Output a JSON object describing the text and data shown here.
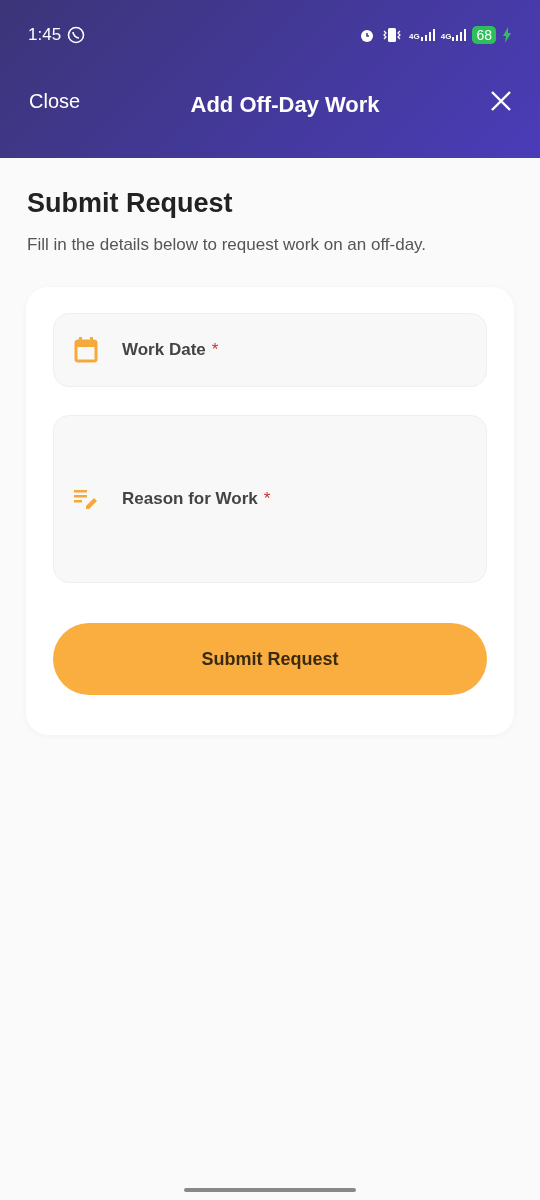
{
  "status_bar": {
    "time": "1:45",
    "network": [
      "4G",
      "4G"
    ],
    "battery": "68"
  },
  "header": {
    "close_label": "Close",
    "title": "Add Off-Day Work"
  },
  "intro": {
    "title": "Submit Request",
    "subtitle": "Fill in the details below to request work on an off-day."
  },
  "form": {
    "fields": [
      {
        "kind": "date",
        "label": "Work Date",
        "required_mark": "*"
      },
      {
        "kind": "textarea",
        "label": "Reason for Work",
        "required_mark": "*"
      }
    ],
    "submit": "Submit Request"
  }
}
